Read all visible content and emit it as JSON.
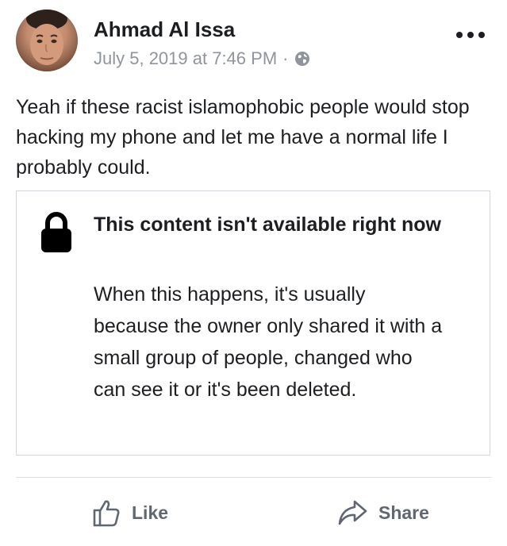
{
  "post": {
    "author": "Ahmad Al Issa",
    "timestamp": "July 5, 2019 at 7:46 PM",
    "separator": "·",
    "privacy_icon": "globe-icon",
    "menu_icon": "more-options-icon",
    "text": "Yeah if these racist islamophobic people would stop hacking my phone and let me have a normal life I probably could."
  },
  "unavailable": {
    "icon": "lock-icon",
    "title": "This content isn't available right now",
    "message": "When this happens, it's usually because the owner only shared it with a small group of people, changed who can see it or it's been deleted."
  },
  "actions": {
    "like_label": "Like",
    "like_icon": "thumbs-up-icon",
    "share_label": "Share",
    "share_icon": "share-arrow-icon"
  },
  "colors": {
    "text": "#1c1e21",
    "secondary_text": "#90949c",
    "action_text": "#606770",
    "border": "#d3d6db"
  }
}
